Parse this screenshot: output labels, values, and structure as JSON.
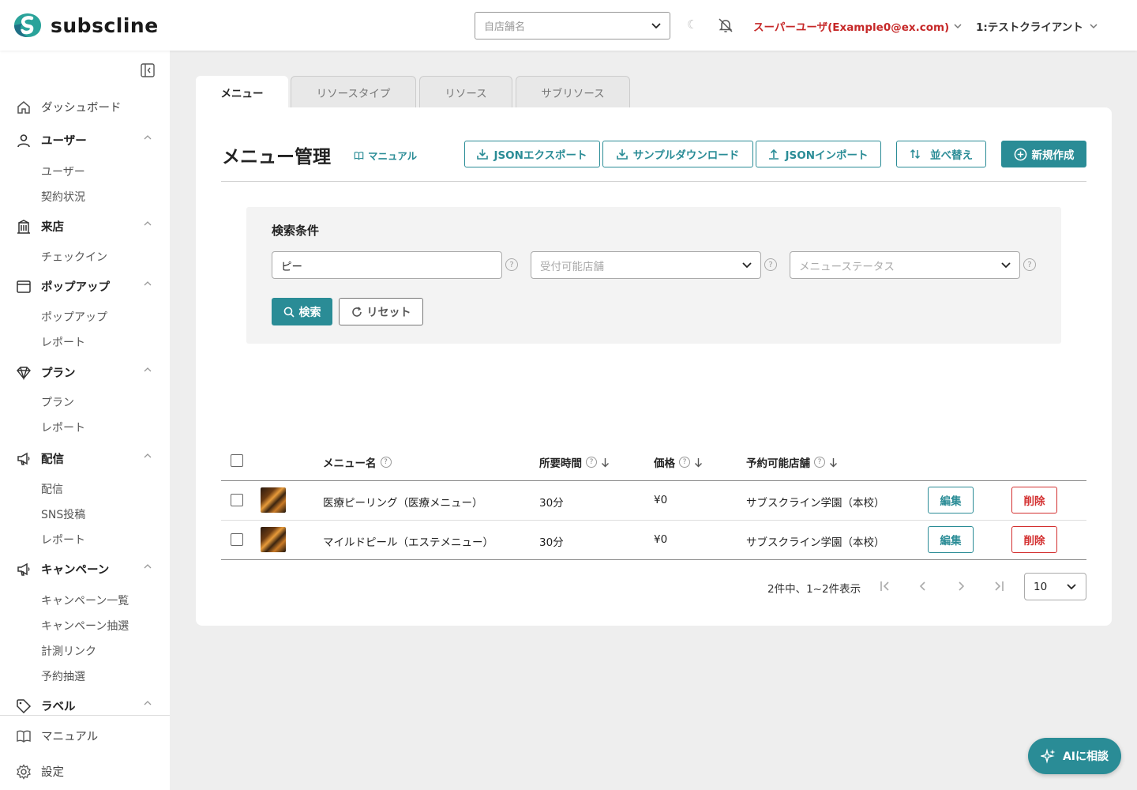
{
  "header": {
    "logo_text": "subscline",
    "store_placeholder": "自店舗名",
    "user_label": "スーパーユーザ(Example0@ex.com)",
    "client_label": "1:テストクライアント"
  },
  "sidebar": {
    "dashboard": "ダッシュボード",
    "groups": [
      {
        "label": "ユーザー",
        "items": [
          "ユーザー",
          "契約状況"
        ]
      },
      {
        "label": "来店",
        "items": [
          "チェックイン"
        ]
      },
      {
        "label": "ポップアップ",
        "items": [
          "ポップアップ",
          "レポート"
        ]
      },
      {
        "label": "プラン",
        "items": [
          "プラン",
          "レポート"
        ]
      },
      {
        "label": "配信",
        "items": [
          "配信",
          "SNS投稿",
          "レポート"
        ]
      },
      {
        "label": "キャンペーン",
        "items": [
          "キャンペーン一覧",
          "キャンペーン抽選",
          "計測リンク",
          "予約抽選"
        ]
      },
      {
        "label": "ラベル",
        "items": []
      }
    ],
    "manual": "マニュアル",
    "settings": "設定"
  },
  "tabs": [
    "メニュー",
    "リソースタイプ",
    "リソース",
    "サブリソース"
  ],
  "page": {
    "title": "メニュー管理",
    "manual_link": "マニュアル",
    "buttons": {
      "json_export": "JSONエクスポート",
      "sample_download": "サンプルダウンロード",
      "json_import": "JSONインポート",
      "sort": "並べ替え",
      "create": "新規作成"
    }
  },
  "search": {
    "label": "検索条件",
    "keyword_value": "ピー",
    "store_placeholder": "受付可能店舗",
    "status_placeholder": "メニューステータス",
    "search_button": "検索",
    "reset_button": "リセット",
    "help_glyph": "?"
  },
  "table": {
    "headers": {
      "name": "メニュー名",
      "duration": "所要時間",
      "price": "価格",
      "store": "予約可能店舗"
    },
    "rows": [
      {
        "name": "医療ピーリング（医療メニュー）",
        "duration": "30分",
        "price": "¥0",
        "store": "サブスクライン学園（本校）",
        "edit": "編集",
        "delete": "削除"
      },
      {
        "name": "マイルドピール（エステメニュー）",
        "duration": "30分",
        "price": "¥0",
        "store": "サブスクライン学園（本校）",
        "edit": "編集",
        "delete": "削除"
      }
    ]
  },
  "pager": {
    "summary": "2件中、1~2件表示",
    "per_page": "10"
  },
  "ai_button": "AIに相談",
  "colors": {
    "accent": "#2a8c96",
    "danger": "#d32f2f",
    "user_red": "#c62828"
  }
}
